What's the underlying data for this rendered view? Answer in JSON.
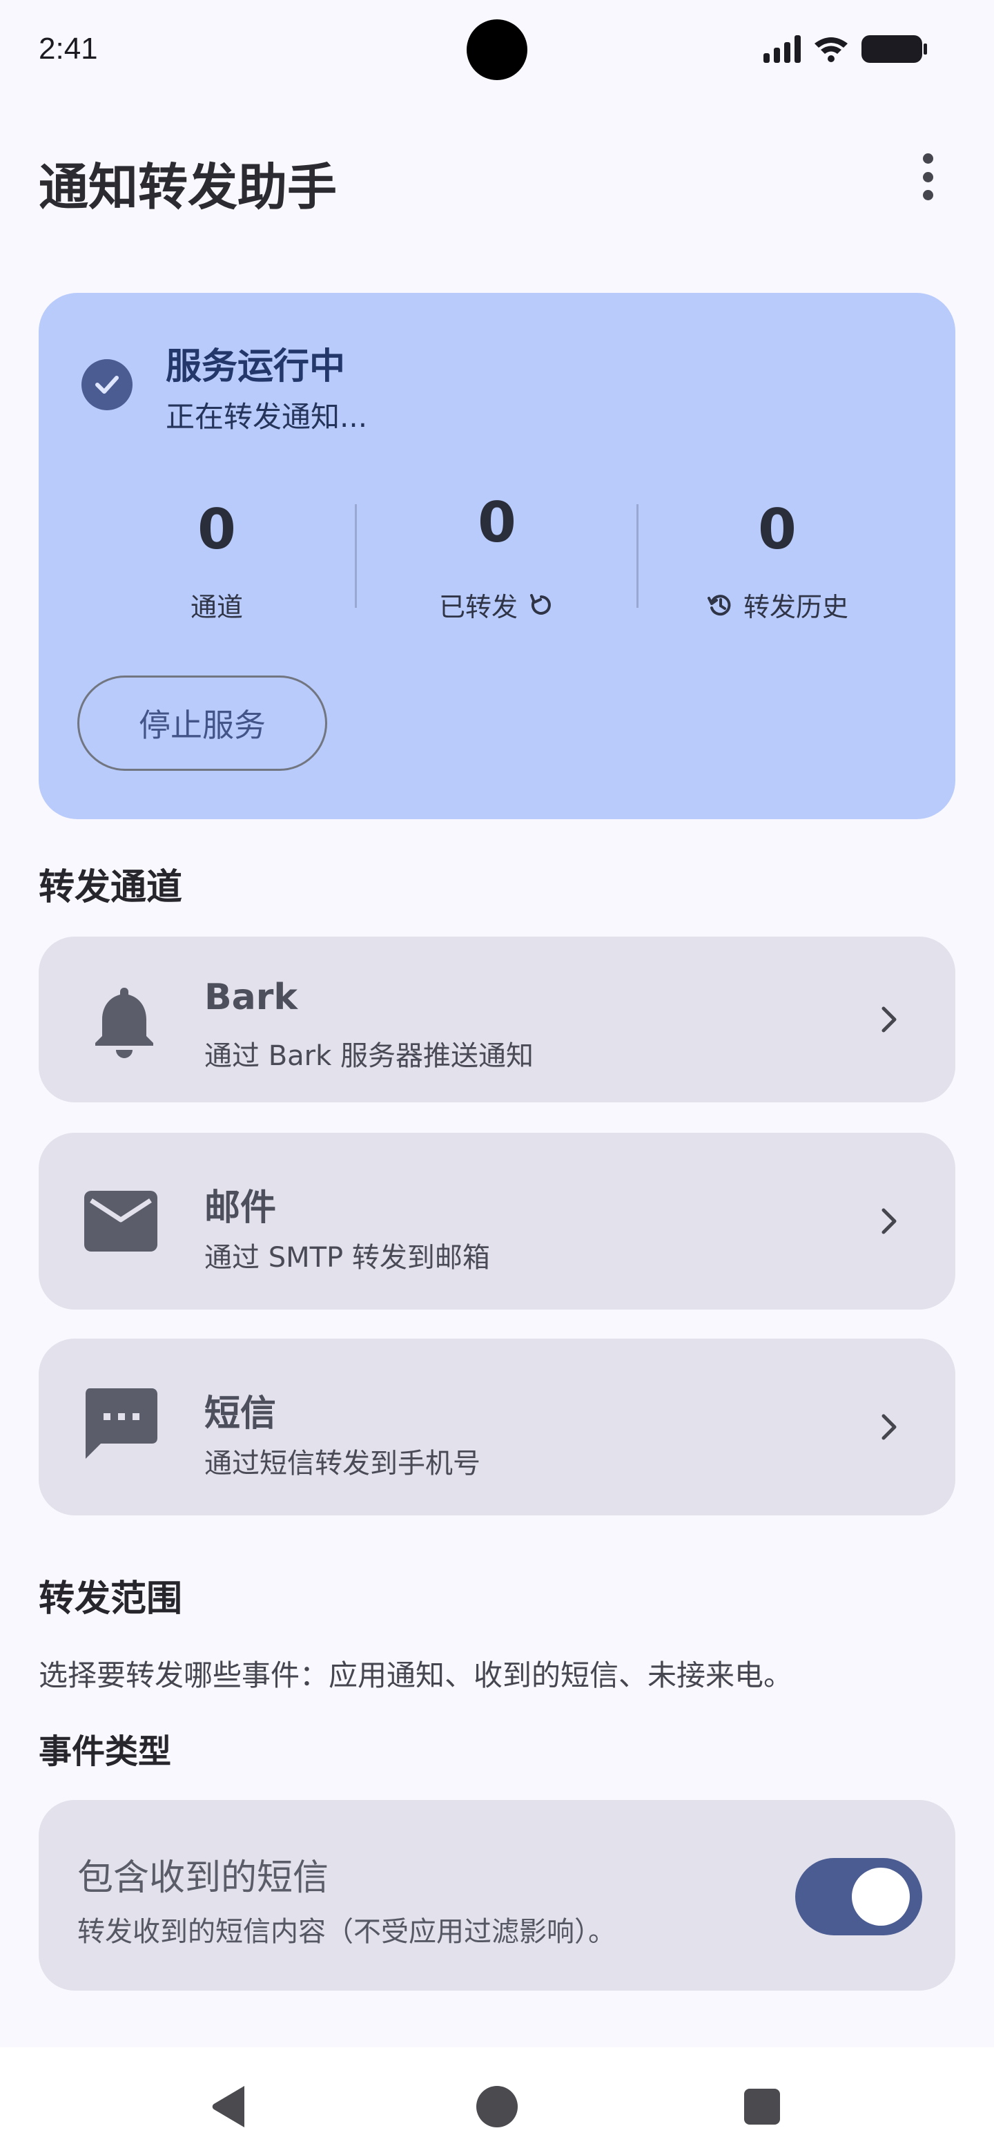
{
  "status_bar": {
    "time": "2:41"
  },
  "app_bar": {
    "title": "通知转发助手",
    "menu_icon": "more-vert-icon"
  },
  "service": {
    "title": "服务运行中",
    "subtitle": "正在转发通知...",
    "status_icon": "check-circle-icon",
    "stats": [
      {
        "value": "0",
        "label": "通道"
      },
      {
        "value": "0",
        "label": "已转发",
        "icon": "refresh-icon"
      },
      {
        "value": "0",
        "label": "转发历史",
        "icon": "history-icon"
      }
    ],
    "stop_label": "停止服务"
  },
  "channels_section": {
    "title": "转发通道",
    "items": [
      {
        "title": "Bark",
        "subtitle": "通过 Bark 服务器推送通知",
        "icon": "bell-icon"
      },
      {
        "title": "邮件",
        "subtitle": "通过 SMTP 转发到邮箱",
        "icon": "mail-icon"
      },
      {
        "title": "短信",
        "subtitle": "通过短信转发到手机号",
        "icon": "sms-icon"
      }
    ]
  },
  "scope_section": {
    "title": "转发范围",
    "description": "选择要转发哪些事件：应用通知、收到的短信、未接来电。",
    "event_types_title": "事件类型",
    "toggle": {
      "title": "包含收到的短信",
      "subtitle": "转发收到的短信内容（不受应用过滤影响）。",
      "checked": true
    }
  },
  "colors": {
    "accent": "#4b5c92",
    "card": "#b9cbfb",
    "surface": "#e2e1ec",
    "background": "#f9f8fe"
  }
}
